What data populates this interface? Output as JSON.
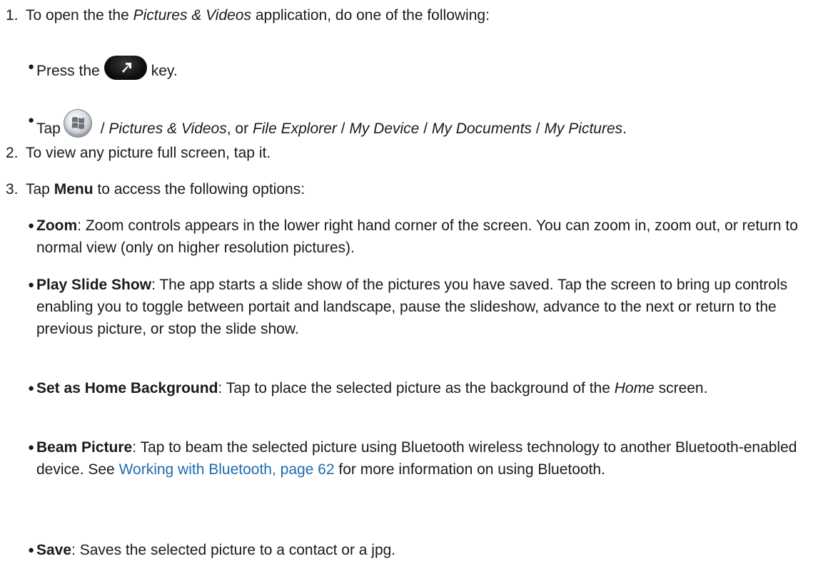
{
  "step1": {
    "number": "1.",
    "text_before": "To open the the ",
    "app_name": "Pictures & Videos",
    "text_after": " application, do one of the following:",
    "bullet_press": {
      "before": "Press the",
      "icon": "arrow-key-icon",
      "after": "key."
    },
    "bullet_tap": {
      "before": "Tap",
      "icon": "windows-start-icon",
      "path1": "Pictures & Videos",
      "or": ", or ",
      "path2": "File Explorer",
      "path3": "My Device",
      "path4": "My Documents",
      "path5": "My Pictures",
      "sep": " / ",
      "end": "."
    }
  },
  "step2": {
    "number": "2.",
    "text": "To view any picture full screen, tap it."
  },
  "step3": {
    "number": "3.",
    "text_before": "Tap ",
    "menu": "Menu",
    "text_after": " to access the following options:",
    "options": [
      {
        "term": "Zoom",
        "desc": ": Zoom controls appears in the lower right hand corner of the screen. You can zoom in, zoom out, or return to normal view (only on higher resolution pictures)."
      },
      {
        "term": "Play Slide Show",
        "desc": ": The app starts a slide show of the pictures you have saved. Tap the screen to bring up controls enabling you to toggle between portait and landscape, pause the slideshow, advance to the next or return to the previous picture, or stop the slide show."
      },
      {
        "term": "Set as Home Background",
        "desc_before": ": Tap to place the selected picture as the background of the ",
        "desc_italic": "Home",
        "desc_after": " screen."
      },
      {
        "term": "Beam Picture",
        "desc_before": ": Tap to beam the selected picture using Bluetooth wireless technology to another Bluetooth-enabled device. See ",
        "link": "Working with Bluetooth, page 62",
        "desc_after": " for more information on using Bluetooth."
      },
      {
        "term": "Save",
        "desc": ": Saves the selected picture to a contact or a jpg."
      }
    ]
  }
}
